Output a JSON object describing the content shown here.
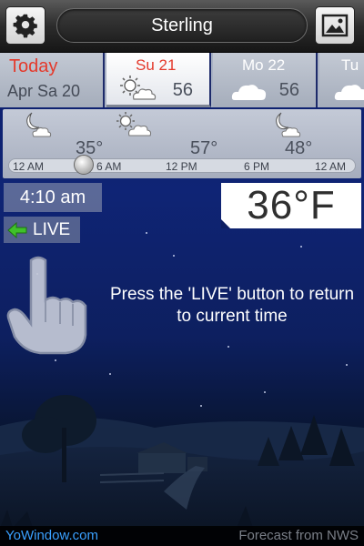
{
  "header": {
    "location": "Sterling",
    "settings_icon": "gear-icon",
    "gallery_icon": "image-icon"
  },
  "days": [
    {
      "label": "Today",
      "sub": "Apr Sa 20",
      "temp": "",
      "icon": "",
      "selected": false
    },
    {
      "label": "Su 21",
      "sub": "",
      "temp": "56",
      "icon": "partly-sunny-icon",
      "selected": true
    },
    {
      "label": "Mo 22",
      "sub": "",
      "temp": "56",
      "icon": "cloud-icon",
      "selected": false
    },
    {
      "label": "Tu",
      "sub": "",
      "temp": "",
      "icon": "cloud-icon",
      "selected": false
    }
  ],
  "hourly": {
    "temps": [
      "35°",
      "57°",
      "48°"
    ],
    "icons": [
      "moon-cloud-icon",
      "partly-sunny-icon",
      "moon-cloud-icon"
    ],
    "ticks": [
      "12 AM",
      "6 AM",
      "12 PM",
      "6 PM",
      "12 AM"
    ]
  },
  "readout": {
    "time": "4:10 am",
    "live_label": "LIVE",
    "temperature": "36°F"
  },
  "hint": {
    "text": "Press the 'LIVE' button to return to current time"
  },
  "footer": {
    "link": "YoWindow.com",
    "credit": "Forecast from NWS"
  },
  "colors": {
    "today_red": "#e43a2c",
    "link_blue": "#3aa0ff",
    "sky_night": "#0f2475"
  }
}
